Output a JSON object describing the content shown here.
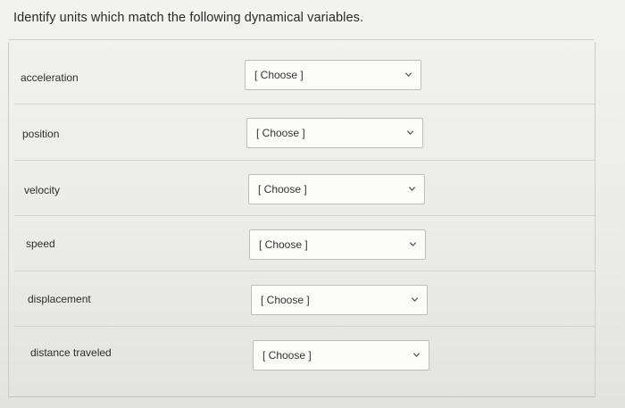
{
  "question": {
    "title": "Identify units which match the following dynamical variables."
  },
  "rows": [
    {
      "prompt": "acceleration",
      "selected": "[ Choose ]"
    },
    {
      "prompt": "position",
      "selected": "[ Choose ]"
    },
    {
      "prompt": "velocity",
      "selected": "[ Choose ]"
    },
    {
      "prompt": "speed",
      "selected": "[ Choose ]"
    },
    {
      "prompt": "displacement",
      "selected": "[ Choose ]"
    },
    {
      "prompt": "distance traveled",
      "selected": "[ Choose ]"
    }
  ],
  "icons": {
    "select_arrow": "chevron-down-icon"
  },
  "colors": {
    "background": "#efefec",
    "text": "#2a2a2a",
    "border": "#bdbdb9"
  }
}
